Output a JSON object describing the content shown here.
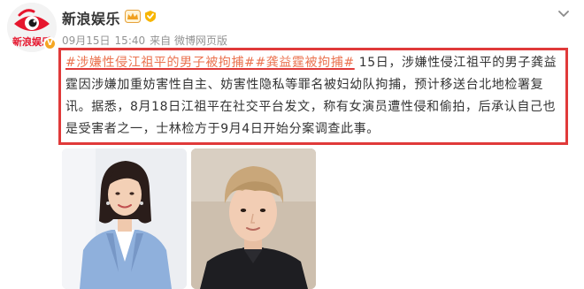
{
  "user": {
    "name": "新浪娱乐",
    "avatar_icon": "sina-eye-logo",
    "verified_icon": "verified-v-icon",
    "vip_icon": "vip-crown-icon",
    "member_icon": "member-badge-icon"
  },
  "post": {
    "date": "09月15日",
    "time": "15:40",
    "source": "来自 微博网页版",
    "hashtag_1": "#涉嫌性侵江祖平的男子被拘捕#",
    "hashtag_2": "#龚益霆被拘捕#",
    "body_1": " 15日，涉嫌性侵江祖平的男子龚益霆因涉嫌加重妨害性自主、妨害性隐私等罪名被妇幼队拘捕，预计移送台北地检署复讯。据悉，8月18日江祖平在社交平台发文，称有女演员遭性侵和偷拍，后承认自己也是受害者之一，士林检方于9月4日开始分案调查此事。",
    "hashtag_color": "#eb7350",
    "highlight_color": "#e03a3a"
  },
  "images": [
    {
      "name": "photo-woman-blue-blazer"
    },
    {
      "name": "photo-man-selfie"
    }
  ],
  "toolbar": {
    "more_icon": "chevron-down-icon"
  }
}
